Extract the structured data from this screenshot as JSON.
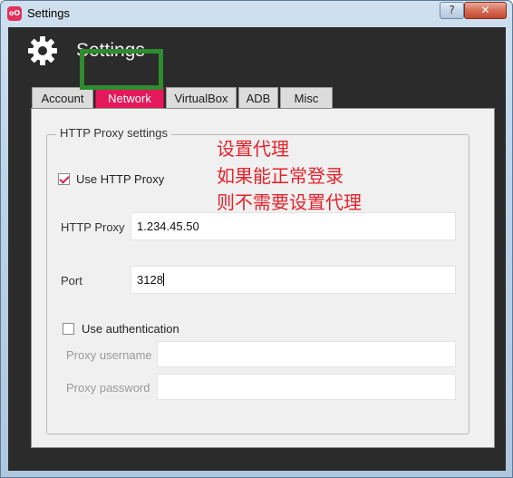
{
  "window": {
    "title": "Settings",
    "app_icon": "oO",
    "help_label": "?",
    "close_label": "✕"
  },
  "header": {
    "title": "Settings",
    "icon": "gear-icon"
  },
  "tabs": [
    {
      "label": "Account",
      "active": false
    },
    {
      "label": "Network",
      "active": true
    },
    {
      "label": "VirtualBox",
      "active": false
    },
    {
      "label": "ADB",
      "active": false
    },
    {
      "label": "Misc",
      "active": false
    }
  ],
  "proxy": {
    "group_title": "HTTP Proxy settings",
    "use_http_proxy": {
      "label": "Use HTTP Proxy",
      "checked": true
    },
    "http_proxy": {
      "label": "HTTP Proxy",
      "value": "1.234.45.50"
    },
    "port": {
      "label": "Port",
      "value": "3128"
    },
    "use_authentication": {
      "label": "Use authentication",
      "checked": false
    },
    "username": {
      "label": "Proxy username",
      "value": ""
    },
    "password": {
      "label": "Proxy password",
      "value": ""
    }
  },
  "annotation": {
    "lines": [
      "设置代理",
      "如果能正常登录",
      "则不需要设置代理"
    ]
  },
  "colors": {
    "accent": "#e3195c",
    "highlight_box": "#2e8b2e",
    "annotation": "#e3232b",
    "client_bg": "#2b2b2b"
  }
}
